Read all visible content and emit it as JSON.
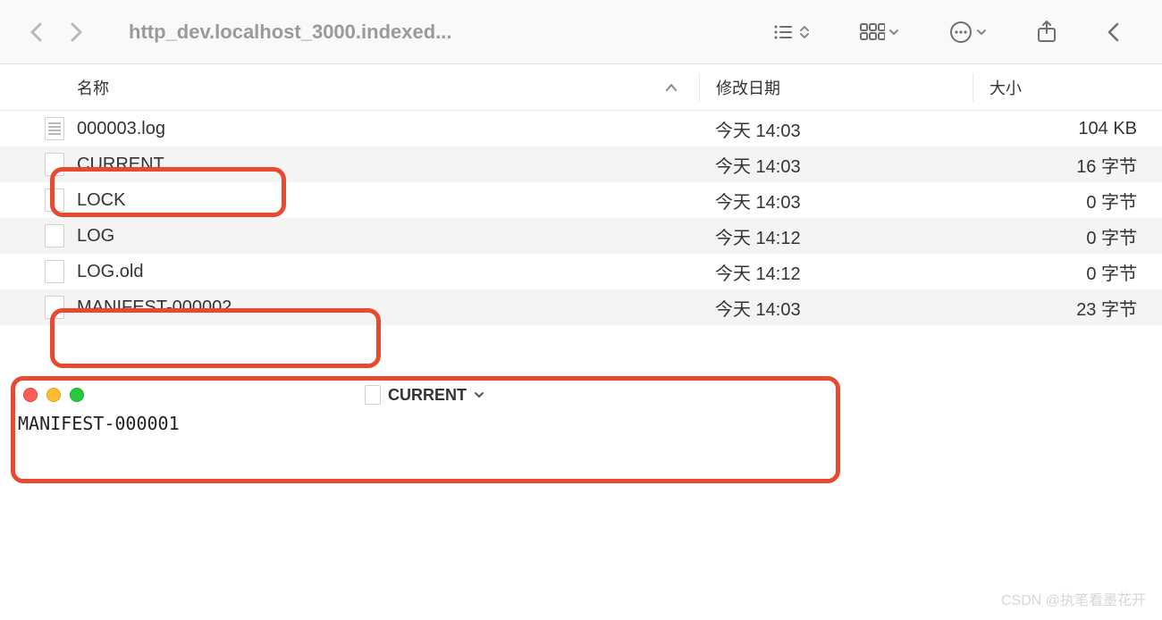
{
  "toolbar": {
    "title": "http_dev.localhost_3000.indexed..."
  },
  "columns": {
    "name": "名称",
    "date": "修改日期",
    "size": "大小"
  },
  "files": [
    {
      "name": "000003.log",
      "date": "今天 14:03",
      "size": "104 KB",
      "icon": "log"
    },
    {
      "name": "CURRENT",
      "date": "今天 14:03",
      "size": "16 字节",
      "icon": "blank"
    },
    {
      "name": "LOCK",
      "date": "今天 14:03",
      "size": "0 字节",
      "icon": "blank"
    },
    {
      "name": "LOG",
      "date": "今天 14:12",
      "size": "0 字节",
      "icon": "blank"
    },
    {
      "name": "LOG.old",
      "date": "今天 14:12",
      "size": "0 字节",
      "icon": "blank"
    },
    {
      "name": "MANIFEST-000002",
      "date": "今天 14:03",
      "size": "23 字节",
      "icon": "blank"
    }
  ],
  "editor": {
    "title": "CURRENT",
    "content": "MANIFEST-000001"
  },
  "watermark": "CSDN @执笔看墨花开"
}
